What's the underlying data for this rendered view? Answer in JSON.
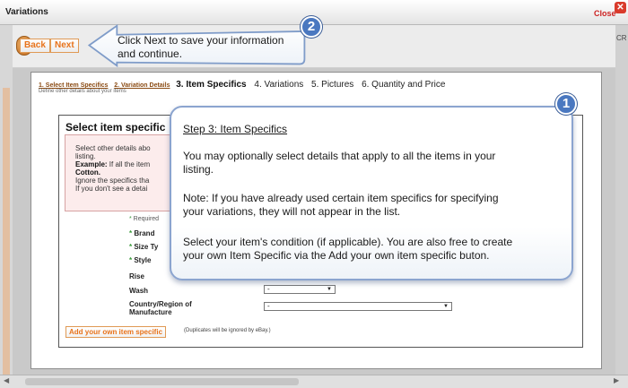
{
  "window": {
    "title": "Variations",
    "close_label": "Close",
    "close_icon": "close-icon"
  },
  "right_edge_text": "CR",
  "toolbar": {
    "back_label": "Back",
    "next_label": "Next"
  },
  "steps": {
    "items": [
      {
        "label": "1. Select Item Specifics",
        "state": "link"
      },
      {
        "label": "2. Variation Details",
        "state": "link"
      },
      {
        "label": "3. Item Specifics",
        "state": "current"
      },
      {
        "label": "4. Variations",
        "state": "plain"
      },
      {
        "label": "5. Pictures",
        "state": "plain"
      },
      {
        "label": "6. Quantity and Price",
        "state": "plain"
      }
    ],
    "subtitle": "Define other details about your items"
  },
  "section": {
    "title": "Select item specific",
    "info_line1": "Select other details abo",
    "info_line2": "listing.",
    "info_example_label": "Example:",
    "info_example_text": " If all the item",
    "info_line4": "Cotton.",
    "info_line5": "Ignore the specifics tha",
    "info_line6": "If you don't see a detai"
  },
  "fields": {
    "required_note": "Required",
    "brand_label": "Brand",
    "size_type_label": "Size Ty",
    "style_label": "Style",
    "rise_label": "Rise",
    "wash_label": "Wash",
    "wash_value": "-",
    "country_label_line1": "Country/Region of",
    "country_label_line2": "Manufacture",
    "country_value": "-"
  },
  "add_specific": {
    "button_label": "Add your own item specific",
    "note": "(Duplicates will be ignored by eBay.)"
  },
  "tooltip_2": {
    "badge": "2",
    "line1": "Click Next to save your information",
    "line2": "and continue."
  },
  "tooltip_1": {
    "badge": "1",
    "heading": "Step 3: Item Specifics",
    "para1_line1": "You may optionally select details that apply to all the items in your",
    "para1_line2": "listing.",
    "para2_line1": "Note:  If you have already used certain item specifics for specifying",
    "para2_line2": "your variations, they will not appear in the list.",
    "para3_line1": "Select your item's condition (if applicable). You are also free to create",
    "para3_line2": "your own Item Specific via the Add your own item specific buton."
  },
  "colors": {
    "accent_orange": "#e8731b",
    "callout_blue": "#4a78c0",
    "callout_border": "#8ba4cf",
    "close_red": "#d93a2b"
  }
}
